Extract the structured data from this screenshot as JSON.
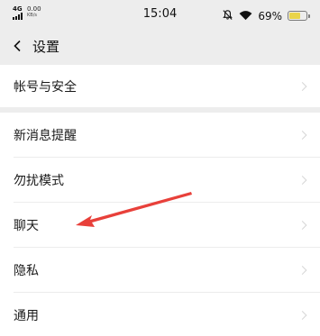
{
  "status_bar": {
    "network": "4G",
    "speed_value": "0.00",
    "speed_unit": "KB/s",
    "time": "15:04",
    "battery_percent": "69%",
    "battery_level": 0.69,
    "battery_color": "#e9d44a",
    "icons": [
      "signal-icon",
      "mute-bell-icon",
      "wifi-icon",
      "battery-icon"
    ]
  },
  "header": {
    "back_icon": "chevron-left-icon",
    "title": "设置"
  },
  "settings": {
    "group1": [
      {
        "label": "帐号与安全"
      }
    ],
    "group2": [
      {
        "label": "新消息提醒"
      },
      {
        "label": "勿扰模式"
      },
      {
        "label": "聊天"
      },
      {
        "label": "隐私"
      },
      {
        "label": "通用"
      }
    ]
  },
  "annotation": {
    "type": "arrow",
    "color": "#e8403a",
    "points_to": "聊天"
  }
}
